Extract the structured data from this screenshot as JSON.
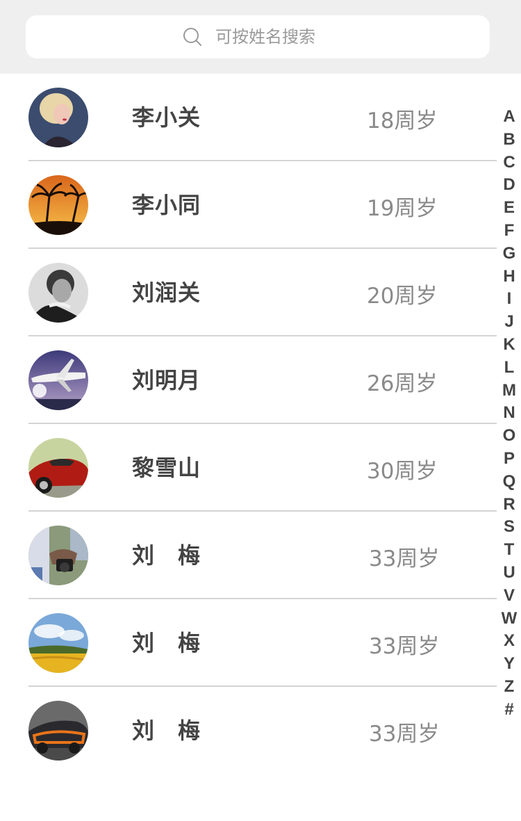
{
  "search": {
    "placeholder": "可按姓名搜索",
    "icon": "search-icon"
  },
  "contacts": [
    {
      "name": "李小关",
      "age": "18周岁",
      "avatar": "portrait-woman-avatar"
    },
    {
      "name": "李小同",
      "age": "19周岁",
      "avatar": "palm-sunset-avatar"
    },
    {
      "name": "刘润关",
      "age": "20周岁",
      "avatar": "portrait-man-avatar"
    },
    {
      "name": "刘明月",
      "age": "26周岁",
      "avatar": "jet-plane-avatar"
    },
    {
      "name": "黎雪山",
      "age": "30周岁",
      "avatar": "red-car-avatar"
    },
    {
      "name": "刘　梅",
      "age": "33周岁",
      "avatar": "camera-hands-avatar"
    },
    {
      "name": "刘　梅",
      "age": "33周岁",
      "avatar": "field-landscape-avatar"
    },
    {
      "name": "刘　梅",
      "age": "33周岁",
      "avatar": "sports-car-avatar"
    }
  ],
  "alphabet_index": [
    "A",
    "B",
    "C",
    "D",
    "E",
    "F",
    "G",
    "H",
    "I",
    "J",
    "K",
    "L",
    "M",
    "N",
    "O",
    "P",
    "Q",
    "R",
    "S",
    "T",
    "U",
    "V",
    "W",
    "X",
    "Y",
    "Z",
    "#"
  ],
  "colors": {
    "header_bg": "#efefef",
    "name_text": "#444444",
    "age_text": "#8a8a8a",
    "divider": "#d4d4d4"
  }
}
